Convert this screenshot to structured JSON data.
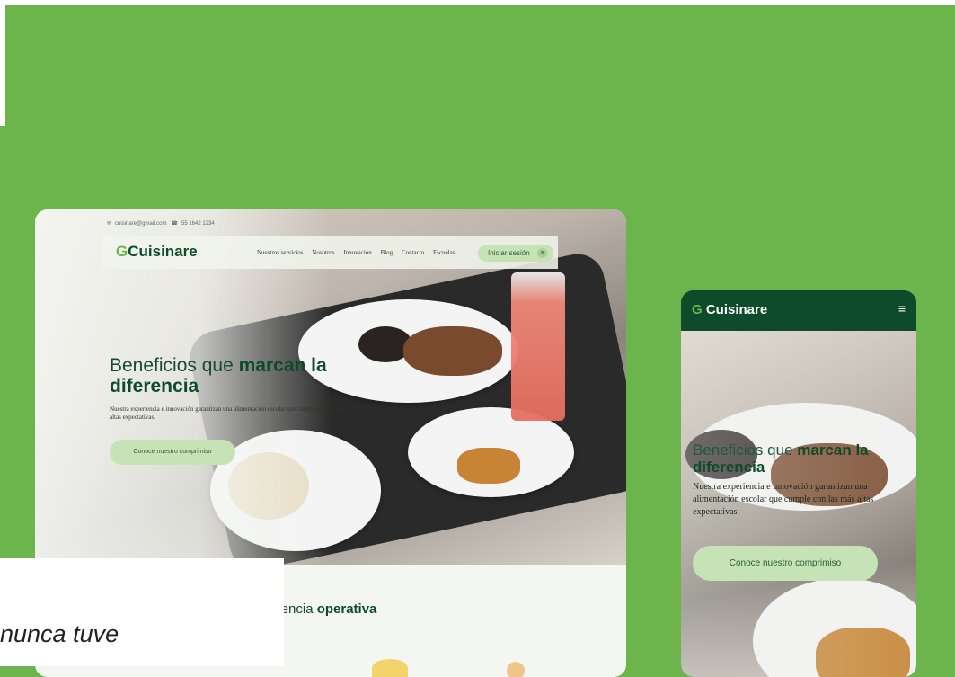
{
  "desktop": {
    "contact": {
      "email": "cuisinare@gmail.com",
      "phone": "55 1642 1234"
    },
    "logo": "Cuisinare",
    "nav": [
      "Nuestros servicios",
      "Nosotros",
      "Innovación",
      "Blog",
      "Contacto",
      "Escuelas"
    ],
    "login_label": "Iniciar sesión",
    "hero": {
      "title_normal": "Beneficios que ",
      "title_bold_1": "marcan la",
      "title_bold_2": "diferencia",
      "subtitle": "Nuestra experiencia e innovación garantizan una alimentación escolar que cumple con las más altas expectativas.",
      "cta": "Conoce nuestro comprimiso"
    },
    "section_title_normal": "elencia ",
    "section_title_bold": "operativa"
  },
  "mobile": {
    "logo": "Cuisinare",
    "menu_icon": "≡",
    "hero": {
      "title_normal": "Beneficios que ",
      "title_bold_1": "marcan la",
      "title_bold_2": "diferencia",
      "subtitle": "Nuestra experiencia e innovación garantizan una alimentación escolar que cumple con las más altas expectativas.",
      "cta": "Conoce nuestro comprimiso"
    }
  },
  "caption": "nunca tuve",
  "colors": {
    "background": "#6cb54d",
    "brand_dark": "#0d4b2b",
    "button_light": "#c6e3b5"
  }
}
